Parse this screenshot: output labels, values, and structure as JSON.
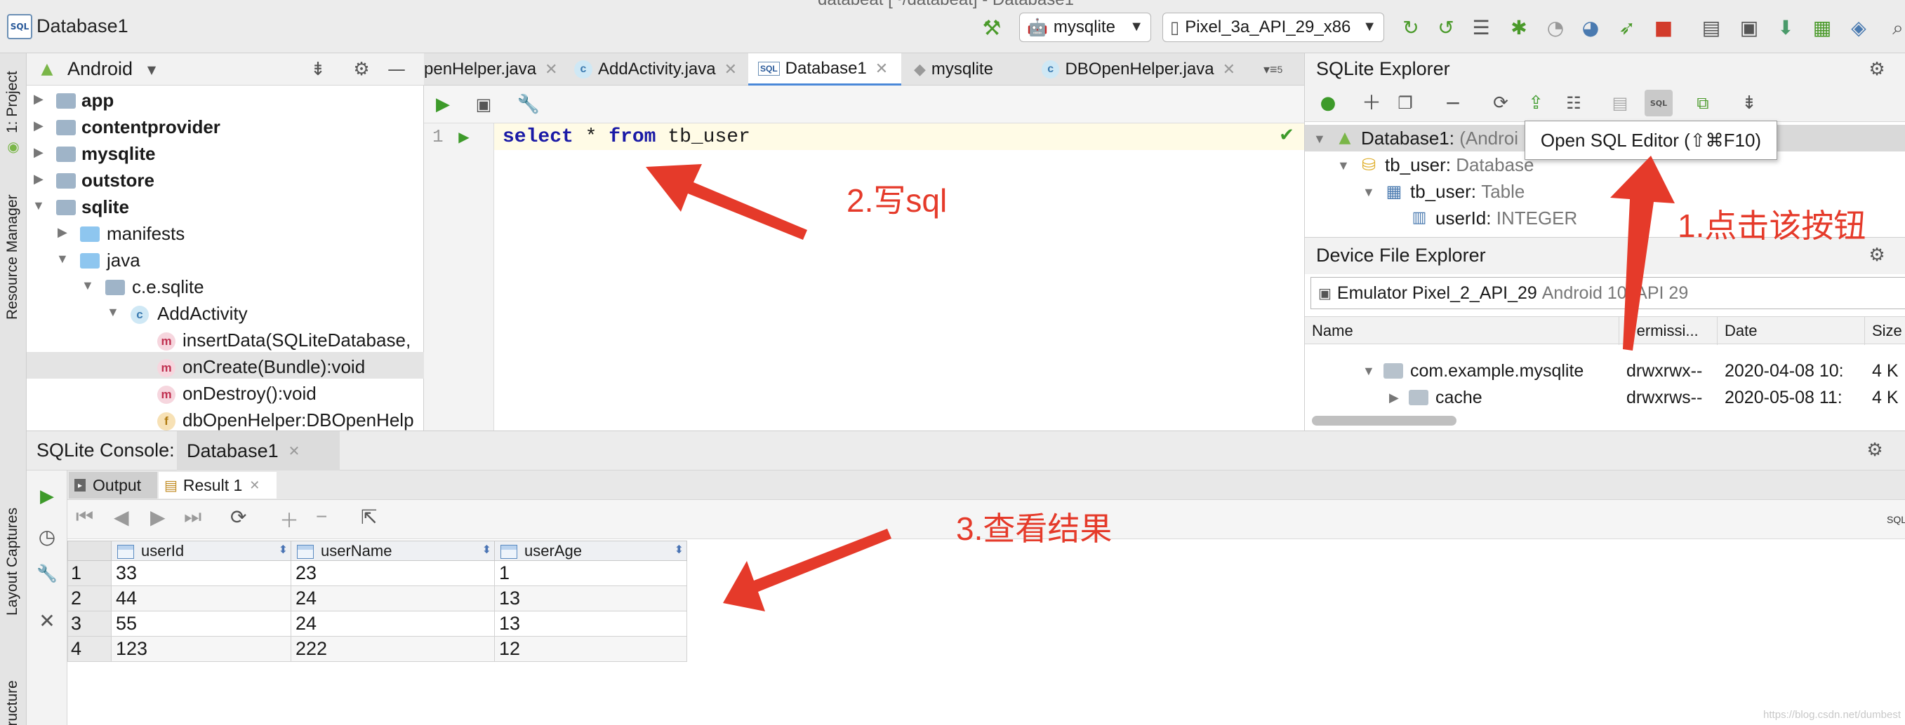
{
  "titlebar": {
    "project": "Database1",
    "window_title": "databeat [~/databeat] - Database1",
    "run_config": "mysqlite",
    "device": "Pixel_3a_API_29_x86"
  },
  "left_strip": {
    "project": "1: Project",
    "resource_manager": "Resource Manager",
    "layout_captures": "Layout Captures",
    "structure": "Z: Structure"
  },
  "project_panel": {
    "view": "Android",
    "tree": [
      "app",
      "contentprovider",
      "mysqlite",
      "outstore",
      "sqlite",
      "manifests",
      "java",
      "c.e.sqlite",
      "AddActivity",
      "insertData(SQLiteDatabase,",
      "onCreate(Bundle):void",
      "onDestroy():void",
      "dbOpenHelper:DBOpenHelp"
    ]
  },
  "editor": {
    "tabs": [
      "penHelper.java",
      "AddActivity.java",
      "Database1",
      "mysqlite",
      "DBOpenHelper.java"
    ],
    "overflow": "5",
    "line_no": "1",
    "code": {
      "k1": "select",
      "mid": " * ",
      "k2": "from",
      "rest": " tb_user"
    }
  },
  "sqlite_explorer": {
    "title": "SQLite Explorer",
    "tree": {
      "db": "Database1:",
      "db_suffix": "(Androi",
      "table_group": "tb_user:",
      "table_group_type": "Database",
      "table": "tb_user:",
      "table_type": "Table",
      "column": "userId:",
      "column_type": "INTEGER"
    },
    "tooltip": "Open SQL Editor (⇧⌘F10)"
  },
  "device_explorer": {
    "title": "Device File Explorer",
    "device": "Emulator Pixel_2_API_29",
    "device_suffix": "Android 10, API 29",
    "columns": [
      "Name",
      "Permissi...",
      "Date",
      "Size"
    ],
    "rows": [
      {
        "name": "com.example.mysqlite",
        "perm": "drwxrwx--",
        "date": "2020-04-08 10:",
        "size": "4 K"
      },
      {
        "name": "cache",
        "perm": "drwxrws--",
        "date": "2020-05-08 11:",
        "size": "4 K"
      }
    ]
  },
  "console": {
    "label": "SQLite Console:",
    "db_tab": "Database1",
    "tabs": [
      "Output",
      "Result 1"
    ],
    "sql_label": "SQL",
    "columns": [
      "userId",
      "userName",
      "userAge"
    ],
    "rows": [
      [
        "1",
        "33",
        "23",
        "1"
      ],
      [
        "2",
        "44",
        "24",
        "13"
      ],
      [
        "3",
        "55",
        "24",
        "13"
      ],
      [
        "4",
        "123",
        "222",
        "12"
      ]
    ]
  },
  "annotations": {
    "step1": "1.点击该按钮",
    "step2": "2.写sql",
    "step3": "3.查看结果",
    "color": "#e53a2a"
  },
  "watermark": "https://blog.csdn.net/dumbest"
}
